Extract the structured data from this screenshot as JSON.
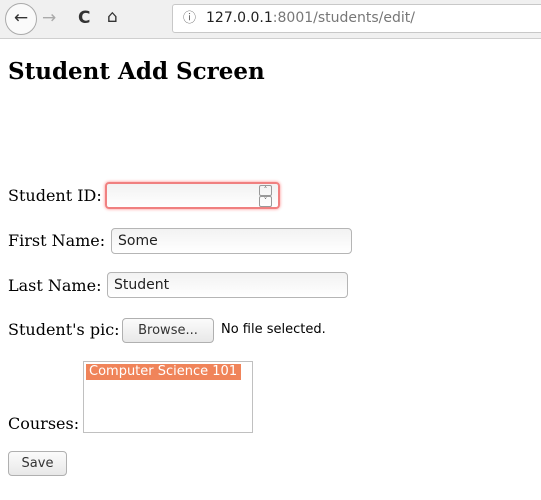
{
  "browser": {
    "url_host": "127.0.0.1",
    "url_rest": ":8001/students/edit/",
    "back_icon": "←",
    "forward_icon": "→",
    "reload_icon": "C",
    "home_icon": "⌂",
    "info_icon": "ⓘ"
  },
  "page": {
    "title": "Student Add Screen"
  },
  "form": {
    "student_id_label": "Student ID:",
    "student_id_value": "",
    "first_name_label": "First Name:",
    "first_name_value": "Some",
    "last_name_label": "Last Name:",
    "last_name_value": "Student",
    "pic_label": "Student's pic:",
    "browse_label": "Browse...",
    "no_file": "No file selected.",
    "courses_label": "Courses:",
    "courses_options": [
      "Computer Science 101"
    ],
    "save_label": "Save",
    "highlight_color": "#f0845a",
    "invalid_border_color": "#f08080"
  }
}
